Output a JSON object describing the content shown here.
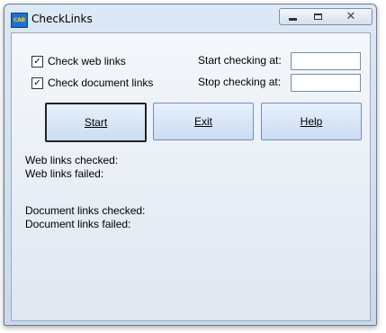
{
  "window": {
    "title": "CheckLinks",
    "icon_text": "CAB"
  },
  "options": {
    "check_web_links": {
      "label": "Check web links",
      "checked": true,
      "mark": "✓"
    },
    "check_document_links": {
      "label": "Check document links",
      "checked": true,
      "mark": "✓"
    }
  },
  "schedule": {
    "start_label": "Start checking at:",
    "start_value": "",
    "stop_label": "Stop checking at:",
    "stop_value": ""
  },
  "buttons": {
    "start": "Start",
    "exit": "Exit",
    "help": "Help"
  },
  "stats": {
    "web_checked": "Web links checked:",
    "web_failed": "Web links failed:",
    "doc_checked": "Document links checked:",
    "doc_failed": "Document links failed:"
  },
  "colors": {
    "button_face": "#dbe7f7",
    "client_bg": "#eef3f9"
  }
}
